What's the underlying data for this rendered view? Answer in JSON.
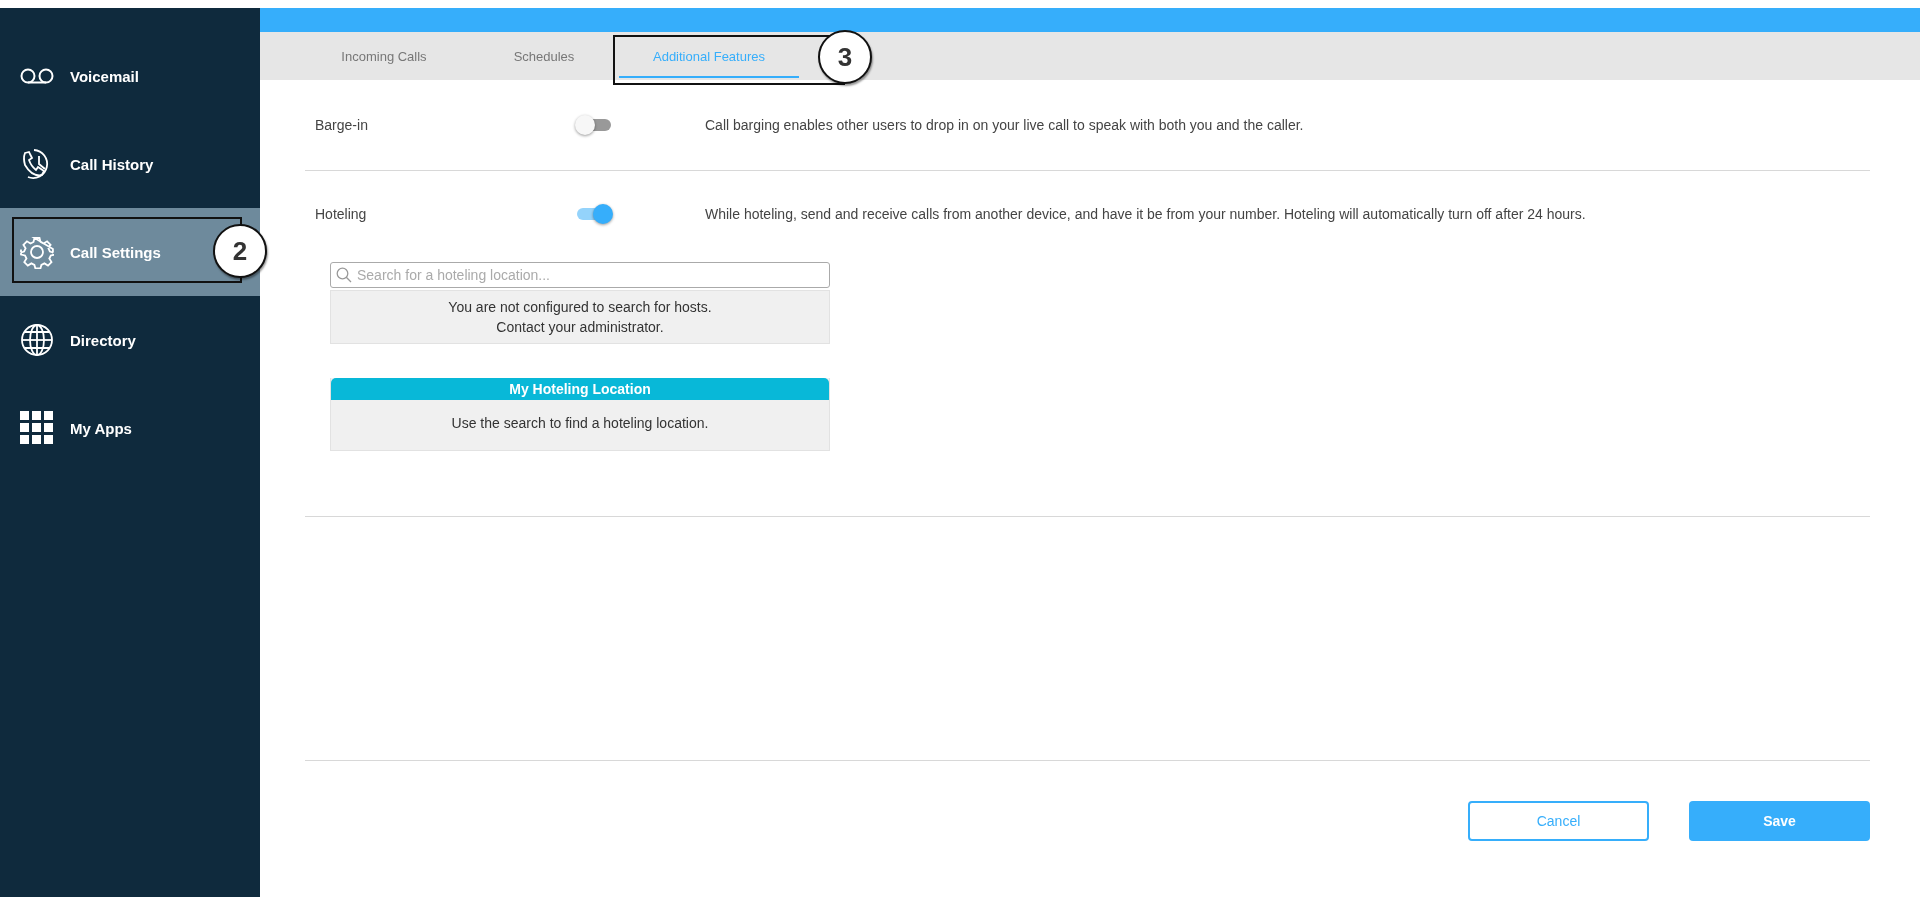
{
  "sidebar": {
    "items": [
      {
        "label": "Voicemail",
        "selected": false
      },
      {
        "label": "Call History",
        "selected": false
      },
      {
        "label": "Call Settings",
        "selected": true,
        "callout": "2"
      },
      {
        "label": "Directory",
        "selected": false
      },
      {
        "label": "My Apps",
        "selected": false
      }
    ]
  },
  "tabs": [
    {
      "label": "Incoming Calls",
      "selected": false
    },
    {
      "label": "Schedules",
      "selected": false
    },
    {
      "label": "Additional Features",
      "selected": true,
      "callout": "3"
    }
  ],
  "features": [
    {
      "label": "Barge-in",
      "on": false,
      "description": "Call barging enables other users to drop in on your live call to speak with both you and the caller."
    },
    {
      "label": "Hoteling",
      "on": true,
      "description": "While hoteling, send and receive calls from another device, and have it be from your number. Hoteling will automatically turn off after 24 hours."
    }
  ],
  "hoteling": {
    "search": {
      "placeholder": "Search for a hoteling location..."
    },
    "message": [
      "You are not configured to search for hosts.",
      "Contact your administrator."
    ],
    "location": {
      "title": "My Hoteling Location",
      "text": "Use the search to find a hoteling location."
    }
  },
  "buttons": [
    {
      "label": "Cancel",
      "kind": "secondary"
    },
    {
      "label": "Save",
      "kind": "primary"
    }
  ]
}
